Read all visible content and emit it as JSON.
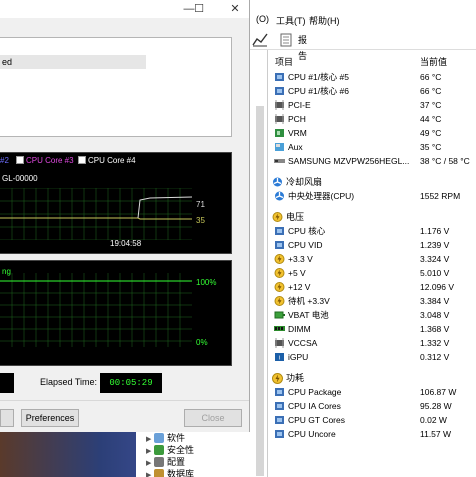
{
  "dialog": {
    "status_row_text": "ed",
    "legend": [
      {
        "label": "#2",
        "color": "#6f6fff"
      },
      {
        "label": "CPU Core #3",
        "color": "#e24ae2"
      },
      {
        "label": "CPU Core #4",
        "color": "#ffffff"
      }
    ],
    "device_label": "GL-00000",
    "temp_axis": {
      "upper": "71",
      "lower": "35",
      "time": "19:04:58"
    },
    "usage_axis": {
      "left_label": "ng",
      "upper": "100%",
      "lower": "0%"
    },
    "elapsed_label": "Elapsed Time:",
    "elapsed_value": "00:05:29",
    "preferences_button": "Preferences",
    "close_button": "Close"
  },
  "desktop_tree": [
    {
      "label": "软件",
      "icon_color": "#6aa0d8"
    },
    {
      "label": "安全性",
      "icon_color": "#3c9a3c"
    },
    {
      "label": "配置",
      "icon_color": "#777777"
    },
    {
      "label": "数据库",
      "icon_color": "#c09030"
    }
  ],
  "app": {
    "menu": [
      "(O)",
      "工具(T)",
      "帮助(H)"
    ],
    "toolbar": {
      "report_label": "报告"
    },
    "columns": {
      "item": "项目",
      "value": "当前值"
    },
    "sensors": [
      {
        "type": "row",
        "label": "CPU #1/核心 #5",
        "value": "66 °C",
        "icon": "cpu-icon"
      },
      {
        "type": "row",
        "label": "CPU #1/核心 #6",
        "value": "66 °C",
        "icon": "cpu-icon"
      },
      {
        "type": "row",
        "label": "PCI-E",
        "value": "37 °C",
        "icon": "chip-icon"
      },
      {
        "type": "row",
        "label": "PCH",
        "value": "44 °C",
        "icon": "chip-icon"
      },
      {
        "type": "row",
        "label": "VRM",
        "value": "49 °C",
        "icon": "vrm-icon"
      },
      {
        "type": "row",
        "label": "Aux",
        "value": "35 °C",
        "icon": "aux-icon"
      },
      {
        "type": "row",
        "label": "SAMSUNG MZVPW256HEGL...",
        "value": "38 °C / 58 °C",
        "icon": "ssd-icon"
      },
      {
        "type": "gap"
      },
      {
        "type": "section",
        "label": "冷却风扇",
        "icon": "fan-icon"
      },
      {
        "type": "row",
        "label": "中央处理器(CPU)",
        "value": "1552 RPM",
        "icon": "fan-icon"
      },
      {
        "type": "gap"
      },
      {
        "type": "section",
        "label": "电压",
        "icon": "voltage-icon"
      },
      {
        "type": "row",
        "label": "CPU 核心",
        "value": "1.176 V",
        "icon": "cpu-icon"
      },
      {
        "type": "row",
        "label": "CPU VID",
        "value": "1.239 V",
        "icon": "cpu-icon"
      },
      {
        "type": "row",
        "label": "+3.3 V",
        "value": "3.324 V",
        "icon": "voltage-icon"
      },
      {
        "type": "row",
        "label": "+5 V",
        "value": "5.010 V",
        "icon": "voltage-icon"
      },
      {
        "type": "row",
        "label": "+12 V",
        "value": "12.096 V",
        "icon": "voltage-icon"
      },
      {
        "type": "row",
        "label": "待机 +3.3V",
        "value": "3.384 V",
        "icon": "voltage-icon"
      },
      {
        "type": "row",
        "label": "VBAT 电池",
        "value": "3.048 V",
        "icon": "battery-icon"
      },
      {
        "type": "row",
        "label": "DIMM",
        "value": "1.368 V",
        "icon": "dimm-icon"
      },
      {
        "type": "row",
        "label": "VCCSA",
        "value": "1.332 V",
        "icon": "chip-icon"
      },
      {
        "type": "row",
        "label": "iGPU",
        "value": "0.312 V",
        "icon": "gpu-icon"
      },
      {
        "type": "gap"
      },
      {
        "type": "section",
        "label": "功耗",
        "icon": "power-icon"
      },
      {
        "type": "row",
        "label": "CPU Package",
        "value": "106.87 W",
        "icon": "cpu-icon"
      },
      {
        "type": "row",
        "label": "CPU IA Cores",
        "value": "95.28 W",
        "icon": "cpu-icon"
      },
      {
        "type": "row",
        "label": "CPU GT Cores",
        "value": "0.02 W",
        "icon": "cpu-icon"
      },
      {
        "type": "row",
        "label": "CPU Uncore",
        "value": "11.57 W",
        "icon": "cpu-icon"
      }
    ]
  }
}
